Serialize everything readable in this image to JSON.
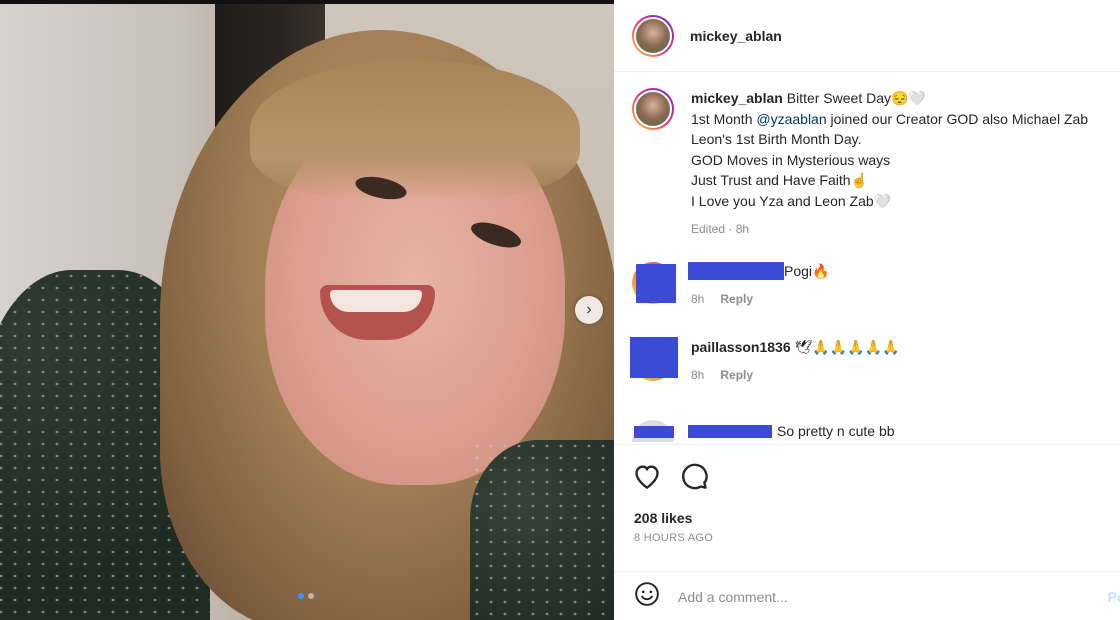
{
  "post": {
    "username": "mickey_ablan",
    "caption": {
      "username": "mickey_ablan",
      "line1_text": " Bitter Sweet Day😔🤍",
      "line2_prefix": "1st Month ",
      "mention": "@yzaablan",
      "line2_suffix": " joined our Creator GOD also Michael Zab Leon's 1st Birth Month Day.",
      "line3": "GOD Moves in Mysterious ways",
      "line4": "Just Trust and Have Faith☝",
      "line5": "I Love you Yza and Leon Zab🤍",
      "meta": "Edited · 8h"
    },
    "comments": [
      {
        "username": "",
        "text": "Pogi🔥",
        "time": "8h",
        "reply": "Reply"
      },
      {
        "username": "paillasson1836",
        "text": " 🕊🙏🙏🙏🙏🙏",
        "time": "8h",
        "reply": "Reply"
      },
      {
        "username": "",
        "text": "So pretty n cute bb"
      }
    ],
    "likes": "208 likes",
    "time_ago": "8 HOURS AGO",
    "add_comment_placeholder": "Add a comment...",
    "post_label": "Post"
  },
  "carousel": {
    "count": 2,
    "active": 0
  },
  "icons": {
    "next": "chevron-right-icon",
    "like": "heart-icon",
    "comment": "speech-bubble-icon",
    "emoji": "smiley-icon"
  },
  "colors": {
    "mention": "#00376b",
    "redaction": "#3b4bd6",
    "muted": "#8e8e8e"
  }
}
